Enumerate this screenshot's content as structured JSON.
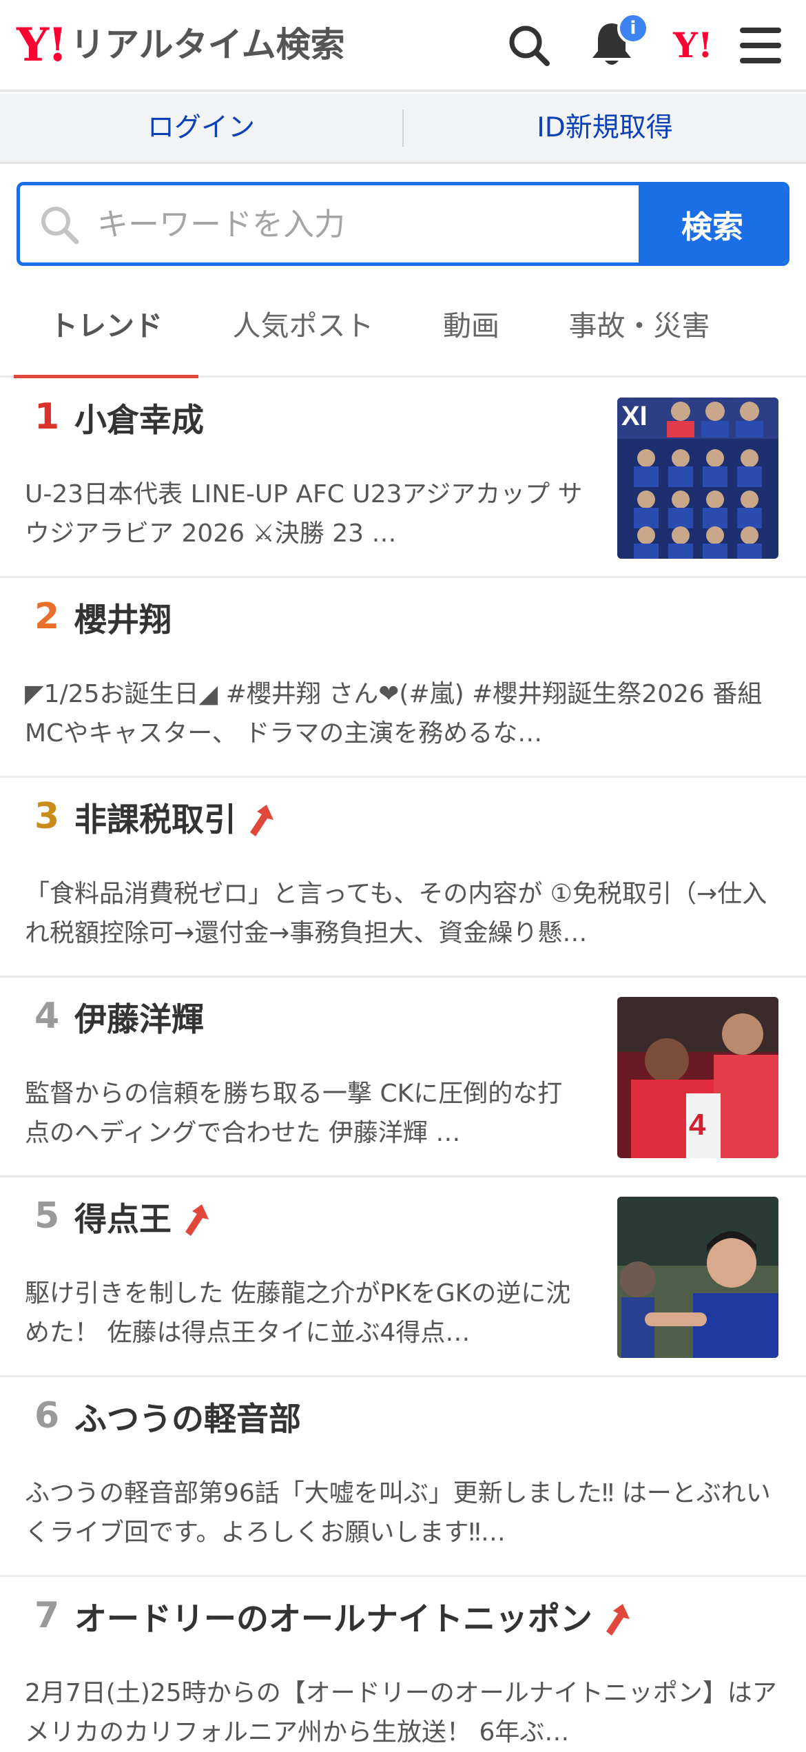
{
  "header": {
    "logo_mark": "Y!",
    "logo_text": "リアルタイム検索",
    "notification_count": "i",
    "yj_mark": "Y!"
  },
  "login_bar": {
    "login": "ログイン",
    "register": "ID新規取得"
  },
  "search": {
    "placeholder": "キーワードを入力",
    "button": "検索"
  },
  "tabs": [
    "トレンド",
    "人気ポスト",
    "動画",
    "事故・災害"
  ],
  "colors": {
    "brand_red": "#ff0033",
    "search_blue": "#1a6fe6",
    "link_blue": "#0b40b6",
    "tab_underline": "#e0483c",
    "rank_1": "#d9332c",
    "rank_2": "#e8702b",
    "rank_3": "#c98c1a",
    "rank_other": "#9a9a9a"
  },
  "trends": [
    {
      "rank": "1",
      "title": "小倉幸成",
      "rising": false,
      "has_thumb": true,
      "thumb_icon": "soccer-lineup-thumbnail",
      "desc": "U-23日本代表 LINE-UP AFC U23アジアカップ サウジアラビア 2026 ⚔決勝 23 …"
    },
    {
      "rank": "2",
      "title": "櫻井翔",
      "rising": false,
      "has_thumb": false,
      "desc": "◤1/25お誕生日◢ #櫻井翔 さん❤(#嵐) #櫻井翔誕生祭2026 番組MCやキャスター、 ドラマの主演を務めるな…"
    },
    {
      "rank": "3",
      "title": "非課税取引",
      "rising": true,
      "has_thumb": false,
      "desc": "「食料品消費税ゼロ」と言っても、その内容が ①免税取引（→仕入れ税額控除可→還付金→事務負担大、資金繰り懸…"
    },
    {
      "rank": "4",
      "title": "伊藤洋輝",
      "rising": false,
      "has_thumb": true,
      "thumb_icon": "bayern-players-thumbnail",
      "desc": "監督からの信頼を勝ち取る一撃 CKに圧倒的な打点のヘディングで合わせた 伊藤洋輝 …"
    },
    {
      "rank": "5",
      "title": "得点王",
      "rising": true,
      "has_thumb": true,
      "thumb_icon": "japan-player-thumbnail",
      "desc": "駆け引きを制した 佐藤龍之介がPKをGKの逆に沈めた！ 佐藤は得点王タイに並ぶ4得点…"
    },
    {
      "rank": "6",
      "title": "ふつうの軽音部",
      "rising": false,
      "has_thumb": false,
      "desc": "ふつうの軽音部第96話「大嘘を叫ぶ」更新しました‼ はーとぶれいくライブ回です。よろしくお願いします‼…"
    },
    {
      "rank": "7",
      "title": "オードリーのオールナイトニッポン",
      "rising": true,
      "has_thumb": false,
      "desc": "2月7日(土)25時からの【オードリーのオールナイトニッポン】はアメリカのカリフォルニア州から生放送！ 6年ぶ…"
    }
  ]
}
